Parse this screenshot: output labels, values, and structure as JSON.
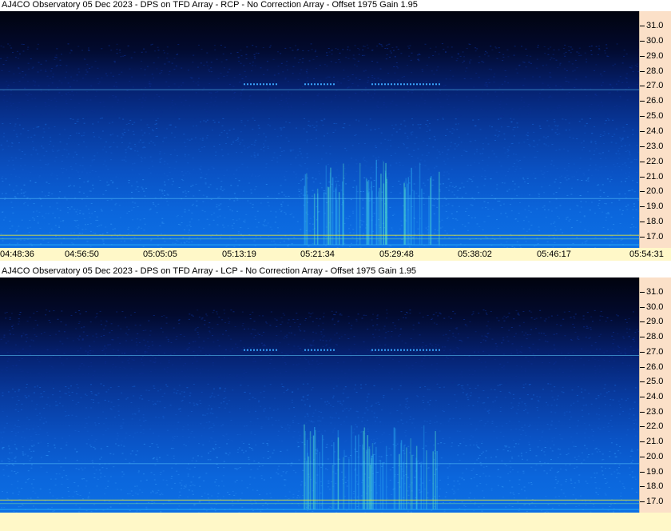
{
  "panels": [
    {
      "title": "AJ4CO Observatory 05 Dec 2023 - DPS on TFD Array  - RCP  -  No Correction Array  -  Offset 1975  Gain 1.95",
      "polarization": "RCP"
    },
    {
      "title": "AJ4CO Observatory 05 Dec 2023 - DPS on TFD Array  - LCP  -  No Correction Array  -  Offset 1975  Gain 1.95",
      "polarization": "LCP"
    }
  ],
  "freq_axis": {
    "labels": [
      "31.0",
      "30.0",
      "29.0",
      "28.0",
      "27.0",
      "26.0",
      "25.0",
      "24.0",
      "23.0",
      "22.0",
      "21.0",
      "20.0",
      "19.0",
      "18.0",
      "17.0"
    ],
    "values": [
      31,
      30,
      29,
      28,
      27,
      26,
      25,
      24,
      23,
      22,
      21,
      20,
      19,
      18,
      17
    ]
  },
  "time_axis": {
    "labels": [
      "04:48:36",
      "04:56:50",
      "05:05:05",
      "05:13:19",
      "05:21:34",
      "05:29:48",
      "05:38:02",
      "05:46:17",
      "05:54:31"
    ]
  },
  "colors": {
    "background_top": "#01030e",
    "background_mid": "#072a8a",
    "background_low": "#0b62d8",
    "interference_line": "#5fd0ff",
    "yellow_line": "#d8e040",
    "axis_panel": "#fbe0c8",
    "time_panel": "#fff8c8"
  }
}
